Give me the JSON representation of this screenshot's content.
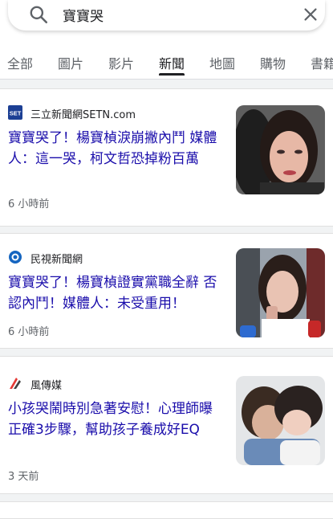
{
  "search": {
    "query": "寶寶哭"
  },
  "tabs": [
    {
      "label": "全部"
    },
    {
      "label": "圖片"
    },
    {
      "label": "影片"
    },
    {
      "label": "新聞"
    },
    {
      "label": "地圖"
    },
    {
      "label": "購物"
    },
    {
      "label": "書籍"
    }
  ],
  "active_tab": "新聞",
  "results": [
    {
      "source": "三立新聞網SETN.com",
      "source_logo_text": "SET",
      "headline": "寶寶哭了！楊寶楨淚崩撇內鬥 媒體人：這一哭，柯文哲恐掉粉百萬",
      "time": "6 小時前"
    },
    {
      "source": "民視新聞網",
      "headline": "寶寶哭了！楊寶楨證實黨職全辭 否認內鬥！媒體人：未受重用！",
      "time": "6 小時前"
    },
    {
      "source": "風傳媒",
      "headline": "小孩哭鬧時別急著安慰！心理師曝正確3步驟，幫助孩子養成好EQ",
      "time": "3 天前"
    }
  ],
  "colors": {
    "link": "#1a0dab",
    "meta": "#5f6368",
    "setn_blue": "#1c3f94",
    "ftv_blue": "#1565c0",
    "storm_red": "#e53935"
  }
}
